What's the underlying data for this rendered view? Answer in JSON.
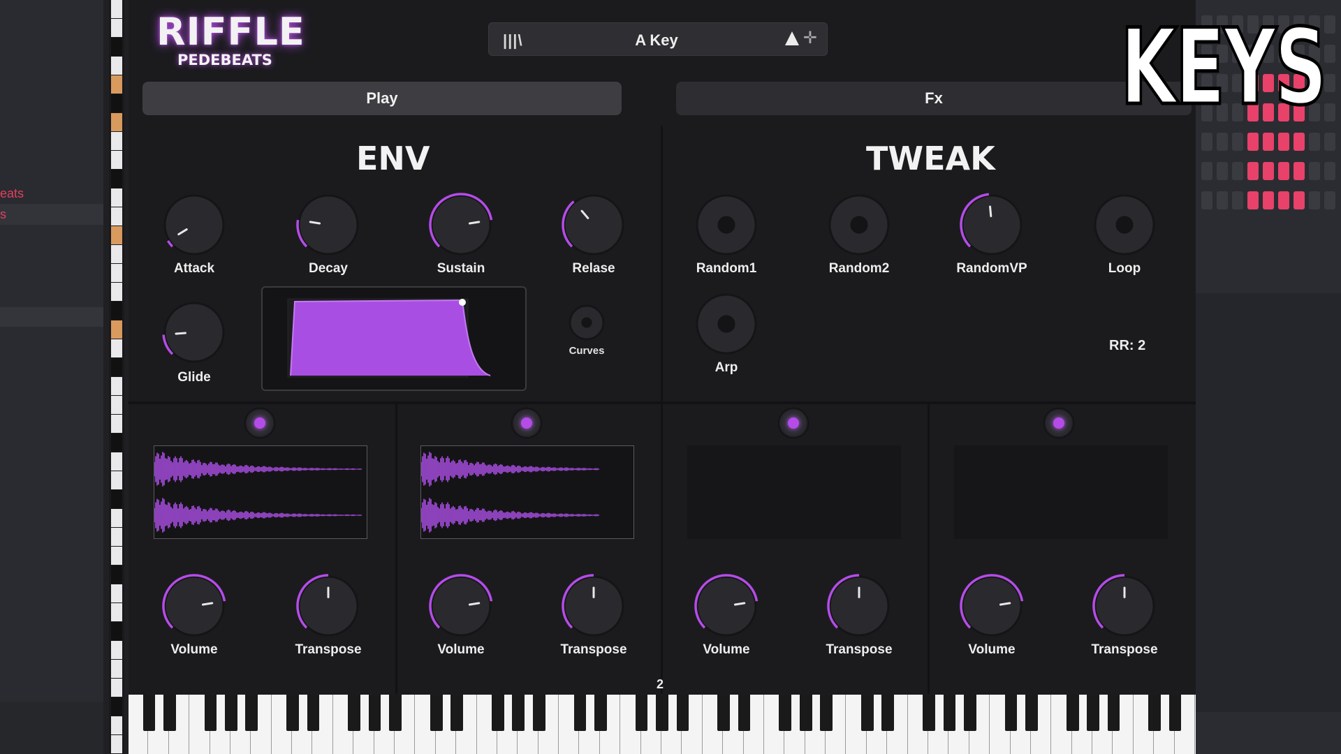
{
  "left_panel": {
    "row1": "eats",
    "row2": "s"
  },
  "brand": {
    "title": "RIFFLE",
    "subtitle": "PEDEBEATS"
  },
  "preset": {
    "browser_icon": "|||\\",
    "name": "A Key",
    "up_icon": "triangle-up-icon",
    "down_icon": "cursor-icon"
  },
  "tabs": {
    "play": "Play",
    "fx": "Fx"
  },
  "env": {
    "title": "ENV",
    "knobs": [
      {
        "label": "Attack",
        "value": 0.05
      },
      {
        "label": "Decay",
        "value": 0.2
      },
      {
        "label": "Sustain",
        "value": 0.8
      },
      {
        "label": "Relase",
        "value": 0.35
      },
      {
        "label": "Glide",
        "value": 0.15
      }
    ],
    "curves_label": "Curves"
  },
  "tweak": {
    "title": "TWEAK",
    "knobs": [
      {
        "label": "Random1",
        "value": 0
      },
      {
        "label": "Random2",
        "value": 0
      },
      {
        "label": "RandomVP",
        "value": 0.48
      },
      {
        "label": "Loop",
        "value": 0
      },
      {
        "label": "Arp",
        "value": 0
      }
    ],
    "rr_label": "RR: 2"
  },
  "layers": [
    {
      "volume_label": "Volume",
      "transpose_label": "Transpose",
      "volume": 0.8,
      "transpose": 0.5,
      "has_sample": true
    },
    {
      "volume_label": "Volume",
      "transpose_label": "Transpose",
      "volume": 0.8,
      "transpose": 0.5,
      "has_sample": true
    },
    {
      "volume_label": "Volume",
      "transpose_label": "Transpose",
      "volume": 0.8,
      "transpose": 0.5,
      "has_sample": false
    },
    {
      "volume_label": "Volume",
      "transpose_label": "Transpose",
      "volume": 0.8,
      "transpose": 0.5,
      "has_sample": false
    }
  ],
  "keyboard": {
    "octave_label": "2"
  },
  "overlay": {
    "text": "KEYS"
  },
  "colors": {
    "accent": "#b54ce8",
    "panel": "#1b1b1e",
    "text": "#eeeeee"
  }
}
